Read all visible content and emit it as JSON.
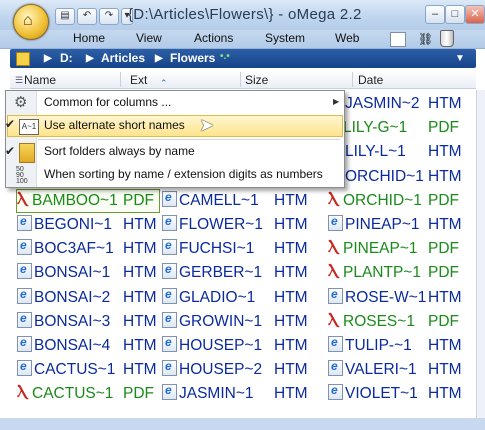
{
  "window": {
    "title": "{D:\\Articles\\Flowers\\} - oMega 2.2",
    "quick_access": [
      "▤",
      "↶",
      "↷",
      "▾"
    ],
    "minimize": "–",
    "maximize": "□",
    "close": "✕"
  },
  "menu": [
    "Home",
    "View",
    "Actions",
    "System",
    "Web"
  ],
  "breadcrumb": {
    "drive": "D:",
    "folder1": "Articles",
    "folder2": "Flowers",
    "sep": "▶",
    "dots": "•.•"
  },
  "columns": {
    "name": "Name",
    "ext": "Ext",
    "size": "Size",
    "date": "Date",
    "sort_arrow": "⌃"
  },
  "context_menu": [
    {
      "label": "Common for columns ...",
      "icon": "gear-icon",
      "checked": false,
      "submenu": true
    },
    {
      "label": "Use alternate short names",
      "icon": "short-names-icon",
      "checked": true,
      "highlighted": true
    },
    {
      "label": "Sort folders always by name",
      "icon": "folder-sort-icon",
      "checked": true
    },
    {
      "label": "When sorting by name / extension digits as numbers",
      "icon": "numeric-sort-icon",
      "checked": false
    }
  ],
  "files": {
    "col1": [
      {
        "name": "",
        "ext": "",
        "type": "none"
      },
      {
        "name": "",
        "ext": "",
        "type": "none"
      },
      {
        "name": "",
        "ext": "",
        "type": "none"
      },
      {
        "name": "",
        "ext": "",
        "type": "none"
      },
      {
        "name": "BAMBOO~1",
        "ext": "PDF",
        "type": "pdf",
        "selected": true
      },
      {
        "name": "BEGONI~1",
        "ext": "HTM",
        "type": "htm"
      },
      {
        "name": "BOC3AF~1",
        "ext": "HTM",
        "type": "htm"
      },
      {
        "name": "BONSAI~1",
        "ext": "HTM",
        "type": "htm"
      },
      {
        "name": "BONSAI~2",
        "ext": "HTM",
        "type": "htm"
      },
      {
        "name": "BONSAI~3",
        "ext": "HTM",
        "type": "htm"
      },
      {
        "name": "BONSAI~4",
        "ext": "HTM",
        "type": "htm"
      },
      {
        "name": "CACTUS~1",
        "ext": "HTM",
        "type": "htm"
      },
      {
        "name": "CACTUS~1",
        "ext": "PDF",
        "type": "pdf"
      }
    ],
    "col2": [
      {
        "name": "",
        "ext": "",
        "type": "none"
      },
      {
        "name": "",
        "ext": "",
        "type": "none"
      },
      {
        "name": "",
        "ext": "",
        "type": "none"
      },
      {
        "name": "",
        "ext": "",
        "type": "none"
      },
      {
        "name": "CAMELL~1",
        "ext": "HTM",
        "type": "htm"
      },
      {
        "name": "FLOWER~1",
        "ext": "HTM",
        "type": "htm"
      },
      {
        "name": "FUCHSI~1",
        "ext": "HTM",
        "type": "htm"
      },
      {
        "name": "GERBER~1",
        "ext": "HTM",
        "type": "htm"
      },
      {
        "name": "GLADIO~1",
        "ext": "HTM",
        "type": "htm"
      },
      {
        "name": "GROWIN~1",
        "ext": "HTM",
        "type": "htm"
      },
      {
        "name": "HOUSEP~1",
        "ext": "HTM",
        "type": "htm"
      },
      {
        "name": "HOUSEP~2",
        "ext": "HTM",
        "type": "htm"
      },
      {
        "name": "JASMIN~1",
        "ext": "HTM",
        "type": "htm"
      }
    ],
    "col3": [
      {
        "name": "JASMIN~2",
        "ext": "HTM",
        "type": "htm"
      },
      {
        "name": "LILY-G~1",
        "ext": "PDF",
        "type": "pdf"
      },
      {
        "name": "LILY-L~1",
        "ext": "HTM",
        "type": "htm"
      },
      {
        "name": "ORCHID~1",
        "ext": "HTM",
        "type": "htm"
      },
      {
        "name": "ORCHID~1",
        "ext": "PDF",
        "type": "pdf"
      },
      {
        "name": "PINEAP~1",
        "ext": "HTM",
        "type": "htm"
      },
      {
        "name": "PINEAP~1",
        "ext": "PDF",
        "type": "pdf"
      },
      {
        "name": "PLANTP~1",
        "ext": "PDF",
        "type": "pdf"
      },
      {
        "name": "ROSE-W~1",
        "ext": "HTM",
        "type": "htm"
      },
      {
        "name": "ROSES~1",
        "ext": "PDF",
        "type": "pdf"
      },
      {
        "name": "TULIP-~1",
        "ext": "HTM",
        "type": "htm"
      },
      {
        "name": "VALERI~1",
        "ext": "HTM",
        "type": "htm"
      },
      {
        "name": "VIOLET~1",
        "ext": "HTM",
        "type": "htm"
      }
    ]
  },
  "colors": {
    "htm": "#0a2a9e",
    "pdf": "#1a8a1a",
    "breadcrumb": "#1f4f96"
  }
}
